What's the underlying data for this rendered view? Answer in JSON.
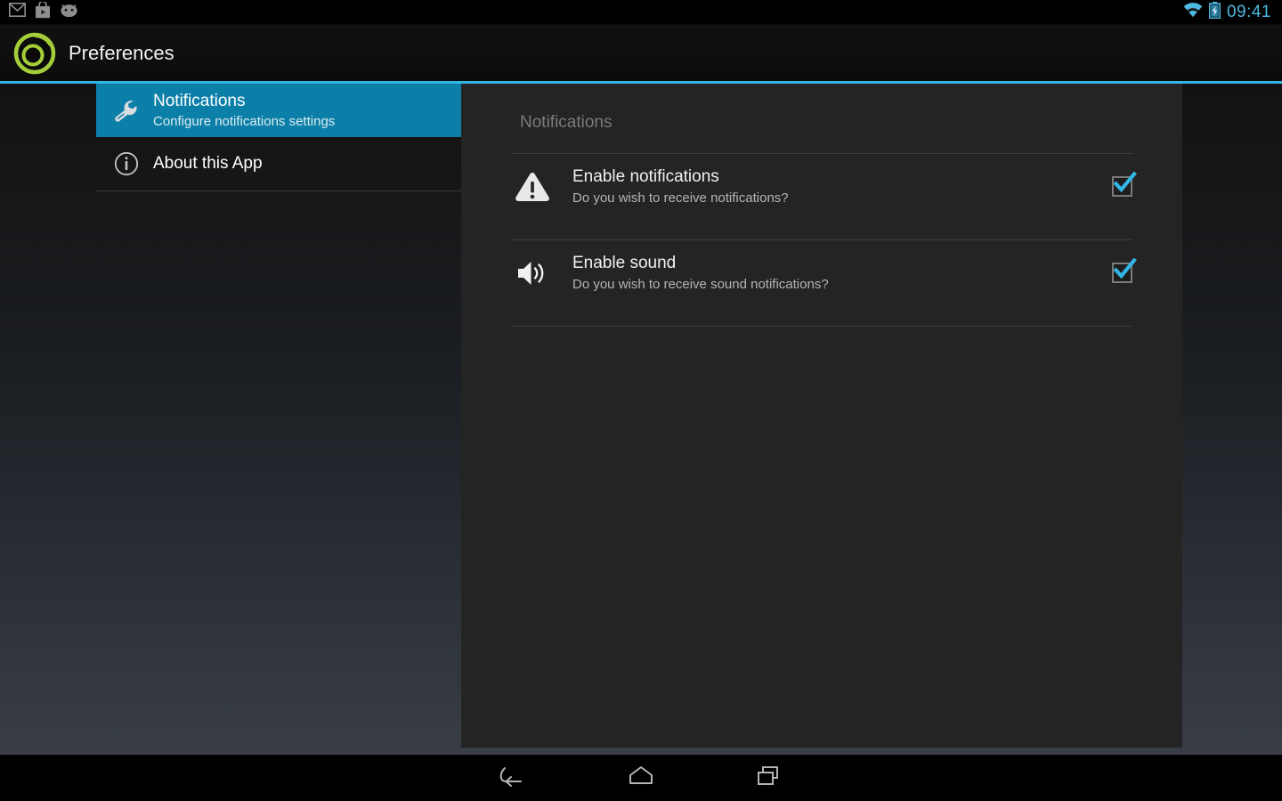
{
  "status_bar": {
    "notification_icons": [
      "gmail-icon",
      "play-store-icon",
      "android-icon"
    ],
    "wifi_icon": "wifi-icon",
    "battery_icon": "battery-charging-icon",
    "time": "09:41",
    "time_color": "#4db8e0"
  },
  "action_bar": {
    "logo_icon": "app-logo-icon",
    "title": "Preferences",
    "accent_color": "#33b5e5"
  },
  "headers": {
    "items": [
      {
        "icon": "wrench-icon",
        "title": "Notifications",
        "summary": "Configure notifications settings",
        "selected": true
      },
      {
        "icon": "info-icon",
        "title": "About this App",
        "summary": "",
        "selected": false
      }
    ],
    "selected_background": "#0c7fa8"
  },
  "preferences": {
    "category": "Notifications",
    "rows": [
      {
        "icon": "warning-triangle-icon",
        "title": "Enable notifications",
        "summary": "Do you wish to receive notifications?",
        "checked": true
      },
      {
        "icon": "speaker-volume-icon",
        "title": "Enable sound",
        "summary": "Do you wish to receive sound notifications?",
        "checked": true
      }
    ],
    "check_color": "#33b5e5"
  },
  "nav_bar": {
    "buttons": [
      {
        "name": "back-button",
        "icon": "back-arrow-icon"
      },
      {
        "name": "home-button",
        "icon": "home-icon"
      },
      {
        "name": "recents-button",
        "icon": "recent-apps-icon"
      }
    ]
  }
}
